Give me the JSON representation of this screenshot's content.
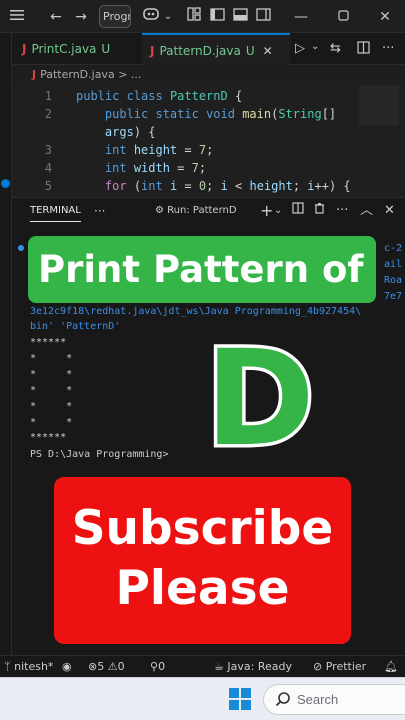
{
  "titlebar": {
    "command_center_text": "Progr",
    "icons": [
      "menu-icon",
      "back-arrow-icon",
      "forward-arrow-icon",
      "copilot-icon",
      "chevron-down-icon",
      "layout-icon",
      "sidebar-icon",
      "panel-icon",
      "secondary-sidebar-icon",
      "minimize-icon",
      "restore-icon",
      "close-icon"
    ]
  },
  "tabs": [
    {
      "file_label": "J",
      "name": "PrintC.java",
      "status": "U",
      "active": false
    },
    {
      "file_label": "J",
      "name": "PatternD.java",
      "status": "U",
      "active": true
    }
  ],
  "breadcrumb": {
    "file_label": "J",
    "file": "PatternD.java",
    "separator": ">",
    "more": "..."
  },
  "editor": {
    "lines": [
      {
        "n": "1",
        "tokens": [
          [
            "kw",
            "public "
          ],
          [
            "kw",
            "class "
          ],
          [
            "ty",
            "PatternD"
          ],
          [
            "pl",
            " {"
          ]
        ]
      },
      {
        "n": "2",
        "tokens": [
          [
            "pl",
            "    "
          ],
          [
            "kw",
            "public "
          ],
          [
            "kw",
            "static "
          ],
          [
            "kw",
            "void "
          ],
          [
            "fn",
            "main"
          ],
          [
            "pl",
            "("
          ],
          [
            "ty",
            "String"
          ],
          [
            "pl",
            "[]"
          ]
        ]
      },
      {
        "n": "",
        "tokens": [
          [
            "pl",
            "    "
          ],
          [
            "var",
            "args"
          ],
          [
            "pl",
            ") {"
          ]
        ]
      },
      {
        "n": "3",
        "tokens": [
          [
            "pl",
            "    "
          ],
          [
            "kw",
            "int "
          ],
          [
            "var",
            "height"
          ],
          [
            "pl",
            " = "
          ],
          [
            "num",
            "7"
          ],
          [
            "pl",
            ";"
          ]
        ]
      },
      {
        "n": "4",
        "tokens": [
          [
            "pl",
            "    "
          ],
          [
            "kw",
            "int "
          ],
          [
            "var",
            "width"
          ],
          [
            "pl",
            " = "
          ],
          [
            "num",
            "7"
          ],
          [
            "pl",
            ";"
          ]
        ]
      },
      {
        "n": "5",
        "tokens": [
          [
            "pl",
            "    "
          ],
          [
            "ctl",
            "for "
          ],
          [
            "pl",
            "("
          ],
          [
            "kw",
            "int "
          ],
          [
            "var",
            "i"
          ],
          [
            "pl",
            " = "
          ],
          [
            "num",
            "0"
          ],
          [
            "pl",
            "; "
          ],
          [
            "var",
            "i"
          ],
          [
            "pl",
            " < "
          ],
          [
            "var",
            "height"
          ],
          [
            "pl",
            "; "
          ],
          [
            "var",
            "i"
          ],
          [
            "pl",
            "++) {"
          ]
        ]
      }
    ]
  },
  "terminal": {
    "tab_label": "TERMINAL",
    "more": "···",
    "run_label": "Run: PatternD",
    "plus": "+",
    "edge_fragments": [
      "c-2",
      "ail",
      "Roa",
      "7e7"
    ],
    "lines": [
      "3e12c9f18\\redhat.java\\jdt_ws\\Java Programming_4b927454\\",
      "bin' 'PatternD'",
      "******",
      "*     *",
      "*     *",
      "*     *",
      "*     *",
      "*     *",
      "******",
      "PS D:\\Java Programming>"
    ]
  },
  "overlays": {
    "title": "Print Pattern of",
    "letter": "D",
    "subscribe_line1": "Subscribe",
    "subscribe_line2": "Please"
  },
  "statusbar": {
    "branch": "nitesh*",
    "errors": "5",
    "warnings": "0",
    "ports": "0",
    "java_status": "Java: Ready",
    "formatter": "Prettier"
  },
  "taskbar": {
    "search_placeholder": "Search"
  },
  "colors": {
    "green_banner": "#35b447",
    "red_banner": "#ee1111",
    "accent": "#0078d4"
  }
}
